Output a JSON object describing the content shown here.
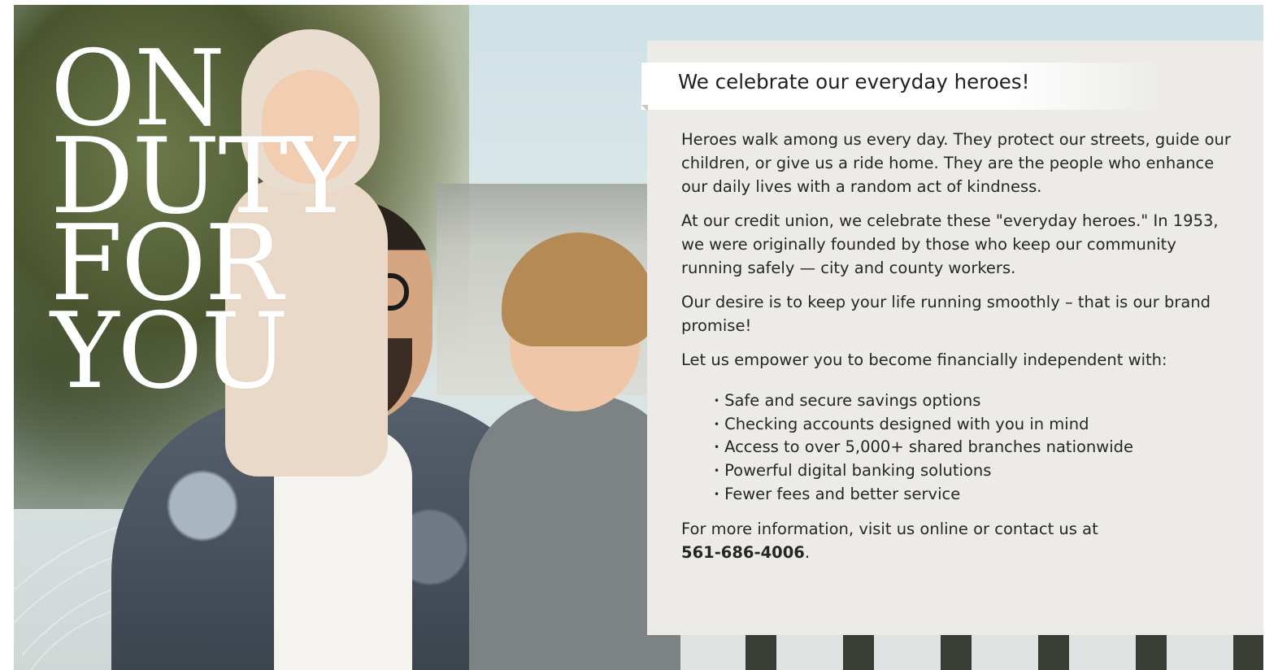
{
  "hero": {
    "title_lines": [
      "ON",
      "DUTY",
      "FOR",
      "YOU"
    ]
  },
  "panel": {
    "headline": "We celebrate our everyday heroes!",
    "paragraphs": [
      "Heroes walk among us every day. They protect our streets, guide our children, or give us a ride home. They are the people who enhance our daily lives with a random act of kindness.",
      "At our credit union, we celebrate these \"everyday heroes.\" In 1953, we were originally founded by those who keep our community running safely — city and county workers.",
      "Our desire is to keep your life running smoothly – that is our brand promise!",
      "Let us empower you to become financially independent with:"
    ],
    "features": [
      "Safe and secure savings options",
      "Checking accounts designed with you in mind",
      "Access to over 5,000+ shared branches nationwide",
      "Powerful digital banking solutions",
      "Fewer fees and better service"
    ],
    "contact_text": "For more information, visit us online or contact us at",
    "contact_phone": "561-686-4006",
    "contact_suffix": "."
  },
  "colors": {
    "panel_bg": "#ecebe8",
    "ribbon": "#ffffff",
    "title_text": "#ffffff",
    "body_text": "#262626"
  }
}
